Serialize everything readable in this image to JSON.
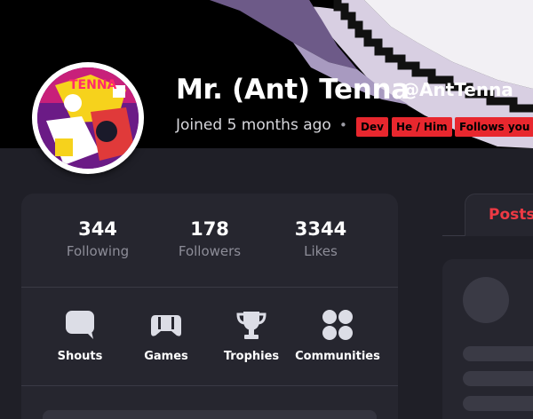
{
  "profile": {
    "display_name": "Mr. (Ant) Tenna",
    "handle": "@AntTenna",
    "joined": "Joined 5 months ago",
    "separator": "•",
    "badges": [
      "Dev",
      "He / Him",
      "Follows you"
    ]
  },
  "stats": [
    {
      "value": "344",
      "label": "Following"
    },
    {
      "value": "178",
      "label": "Followers"
    },
    {
      "value": "3344",
      "label": "Likes"
    }
  ],
  "nav": [
    {
      "label": "Shouts",
      "icon": "speech-bubble-icon"
    },
    {
      "label": "Games",
      "icon": "gamepad-icon"
    },
    {
      "label": "Trophies",
      "icon": "trophy-icon"
    },
    {
      "label": "Communities",
      "icon": "communities-icon"
    }
  ],
  "tabs": {
    "posts": "Posts"
  },
  "colors": {
    "accent_red": "#e8272e",
    "posts_tab_text": "#ee3a44",
    "card_bg": "#26262f",
    "page_bg": "#1f1f27"
  }
}
